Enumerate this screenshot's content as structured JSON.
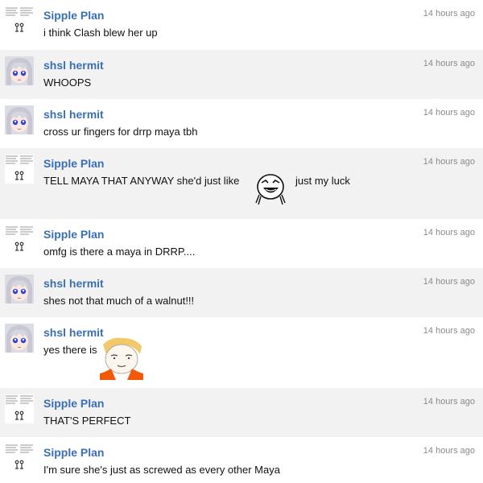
{
  "messages": [
    {
      "user": "Sipple Plan",
      "avatar": "sipple-avatar",
      "time": "14 hours ago",
      "text": "i think Clash blew her up"
    },
    {
      "user": "shsl hermit",
      "avatar": "hermit-avatar",
      "time": "14 hours ago",
      "text": "WHOOPS"
    },
    {
      "user": "shsl hermit",
      "avatar": "hermit-avatar",
      "time": "14 hours ago",
      "text": "cross ur fingers for drrp maya tbh"
    },
    {
      "user": "Sipple Plan",
      "avatar": "sipple-avatar",
      "time": "14 hours ago",
      "text": "TELL MAYA THAT ANYWAY she'd just like",
      "emote": "laughing-face-emote",
      "text_after": "just my luck"
    },
    {
      "user": "Sipple Plan",
      "avatar": "sipple-avatar",
      "time": "14 hours ago",
      "text": "omfg is there a maya in DRRP...."
    },
    {
      "user": "shsl hermit",
      "avatar": "hermit-avatar",
      "time": "14 hours ago",
      "text": "shes not that much of a walnut!!!"
    },
    {
      "user": "shsl hermit",
      "avatar": "hermit-avatar",
      "time": "14 hours ago",
      "text": "yes there is",
      "emote": "maya-face-emote"
    },
    {
      "user": "Sipple Plan",
      "avatar": "sipple-avatar",
      "time": "14 hours ago",
      "text": "THAT'S PERFECT"
    },
    {
      "user": "Sipple Plan",
      "avatar": "sipple-avatar",
      "time": "14 hours ago",
      "text": "I'm sure she's just as screwed as every other Maya"
    }
  ],
  "colors": {
    "username": "#3a6fb5",
    "timestamp": "#8a8a8a",
    "alt_row": "#f2f2f2"
  }
}
